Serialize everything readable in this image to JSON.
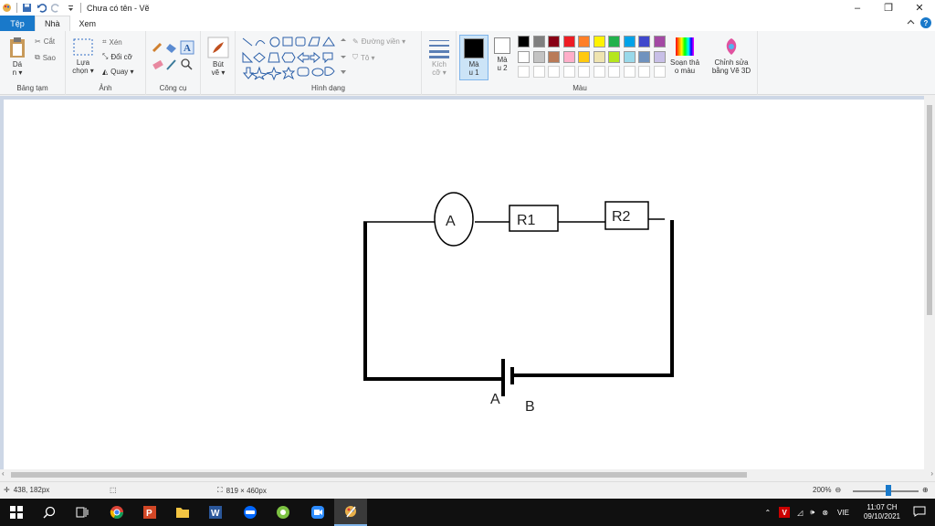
{
  "window": {
    "title": "Chưa có tên - Vẽ",
    "minimize": "–",
    "maximize": "❐",
    "close": "✕"
  },
  "tabs": [
    {
      "label": "Tệp"
    },
    {
      "label": "Nhà"
    },
    {
      "label": "Xem"
    }
  ],
  "ribbon": {
    "clipboard": {
      "label": "Bảng tạm",
      "paste": "Dá\nn ▾",
      "cut": "Cắt",
      "copy": "Sao"
    },
    "image": {
      "label": "Ảnh",
      "select": "Lựa\nchọn ▾",
      "crop": "Xén",
      "resize": "Đổi cỡ",
      "rotate": "Quay ▾"
    },
    "tools": {
      "label": "Công cụ"
    },
    "brushes": {
      "label": "Bút\nvẽ ▾"
    },
    "shapes": {
      "label": "Hình dạng",
      "outline": "Đường viền ▾",
      "fill": "Tô ▾"
    },
    "size": {
      "label": "Kích\ncỡ ▾"
    },
    "colors": {
      "label": "Màu",
      "color1": "Mà\nu 1",
      "color2": "Mà\nu 2",
      "edit": "Soạn thả\no màu",
      "paint3d": "Chỉnh sửa\nbằng Vẽ 3D",
      "palette_row1": [
        "#000000",
        "#7f7f7f",
        "#880015",
        "#ed1c24",
        "#ff7f27",
        "#fff200",
        "#22b14c",
        "#00a2e8",
        "#3f48cc",
        "#a349a4"
      ],
      "palette_row2": [
        "#ffffff",
        "#c3c3c3",
        "#b97a57",
        "#ffaec9",
        "#ffc90e",
        "#efe4b0",
        "#b5e61d",
        "#99d9ea",
        "#7092be",
        "#c8bfe7"
      ]
    }
  },
  "drawing": {
    "ammeter": "A",
    "r1": "R1",
    "r2": "R2",
    "terminal_a": "A",
    "terminal_b": "B"
  },
  "status": {
    "cursor": "438, 182px",
    "canvas_size": "819 × 460px",
    "zoom": "200%"
  },
  "taskbar": {
    "tray_lang": "VIE",
    "time": "11:07 CH",
    "date": "09/10/2021"
  }
}
